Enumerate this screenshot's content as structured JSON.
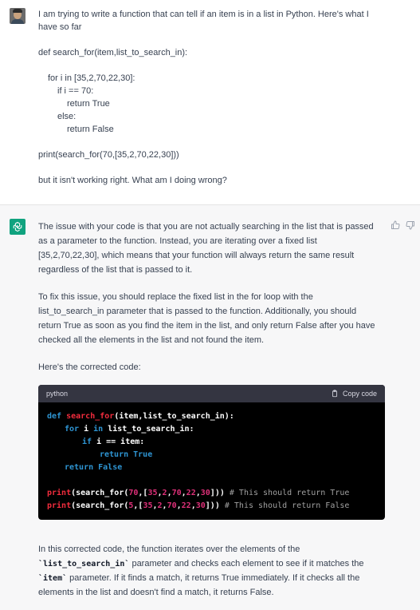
{
  "user": {
    "intro_line1": "I am trying to write a function that can tell if an item is in a list in Python. Here's what I",
    "intro_line2": "have so far",
    "code_lines": [
      "def search_for(item,list_to_search_in):",
      "    for i in [35,2,70,22,30]:",
      "        if i == 70:",
      "            return True",
      "        else:",
      "            return False",
      "print(search_for(70,[35,2,70,22,30]))"
    ],
    "outro": "but it isn't working right. What am I doing wrong?"
  },
  "assistant": {
    "p1_lines": [
      "The issue with your code is that you are not actually searching in the list that is passed",
      "as a parameter to the function. Instead, you are iterating over a fixed list",
      "[35,2,70,22,30], which means that your function will always return the same result",
      "regardless of the list that is passed to it."
    ],
    "p2_lines": [
      "To fix this issue, you should replace the fixed list in the for loop with the",
      "list_to_search_in parameter that is passed to the function. Additionally, you should",
      "return True as soon as you find the item in the list, and only return False after you have",
      "checked all the elements in the list and not found the item."
    ],
    "p3": "Here's the corrected code:",
    "code_language": "python",
    "copy_label": "Copy code",
    "code": {
      "l1_def": "def",
      "l1_fn": "search_for",
      "l1_rest": "(item,list_to_search_in):",
      "l2_for": "for",
      "l2_i": " i ",
      "l2_in": "in",
      "l2_rest": " list_to_search_in:",
      "l3_if": "if",
      "l3_rest": " i == item:",
      "l4_return": "return",
      "l4_val": " True",
      "l5_return": "return",
      "l5_val": " False",
      "l6_print": "print",
      "l6_fn": "(search_for(",
      "l6_n1": "70",
      "l6_mid1": ",[",
      "l6_list": [
        "35",
        "2",
        "70",
        "22",
        "30"
      ],
      "l6_end": "]))",
      "l6_comment": " # This should return True",
      "l7_print": "print",
      "l7_fn": "(search_for(",
      "l7_n1": "5",
      "l7_mid1": ",[",
      "l7_list": [
        "35",
        "2",
        "70",
        "22",
        "30"
      ],
      "l7_end": "]))",
      "l7_comment": " # This should return False"
    },
    "p4_line1": "In this corrected code, the function iterates over the elements of the",
    "p4_line2_code": "`list_to_search_in`",
    "p4_line2_rest": " parameter and checks each element to see if it matches the",
    "p4_line3_code": "`item`",
    "p4_line3_rest": " parameter. If it finds a match, it returns True immediately. If it checks all the",
    "p4_line4": "elements in the list and doesn't find a match, it returns False."
  },
  "icons": {
    "avatar": "user-avatar",
    "bot": "openai-logo-icon",
    "thumbs_up": "thumbs-up-icon",
    "thumbs_down": "thumbs-down-icon",
    "copy": "clipboard-icon"
  },
  "colors": {
    "bot_bg": "#10a37f",
    "code_bg": "#000000",
    "code_header": "#343541"
  }
}
